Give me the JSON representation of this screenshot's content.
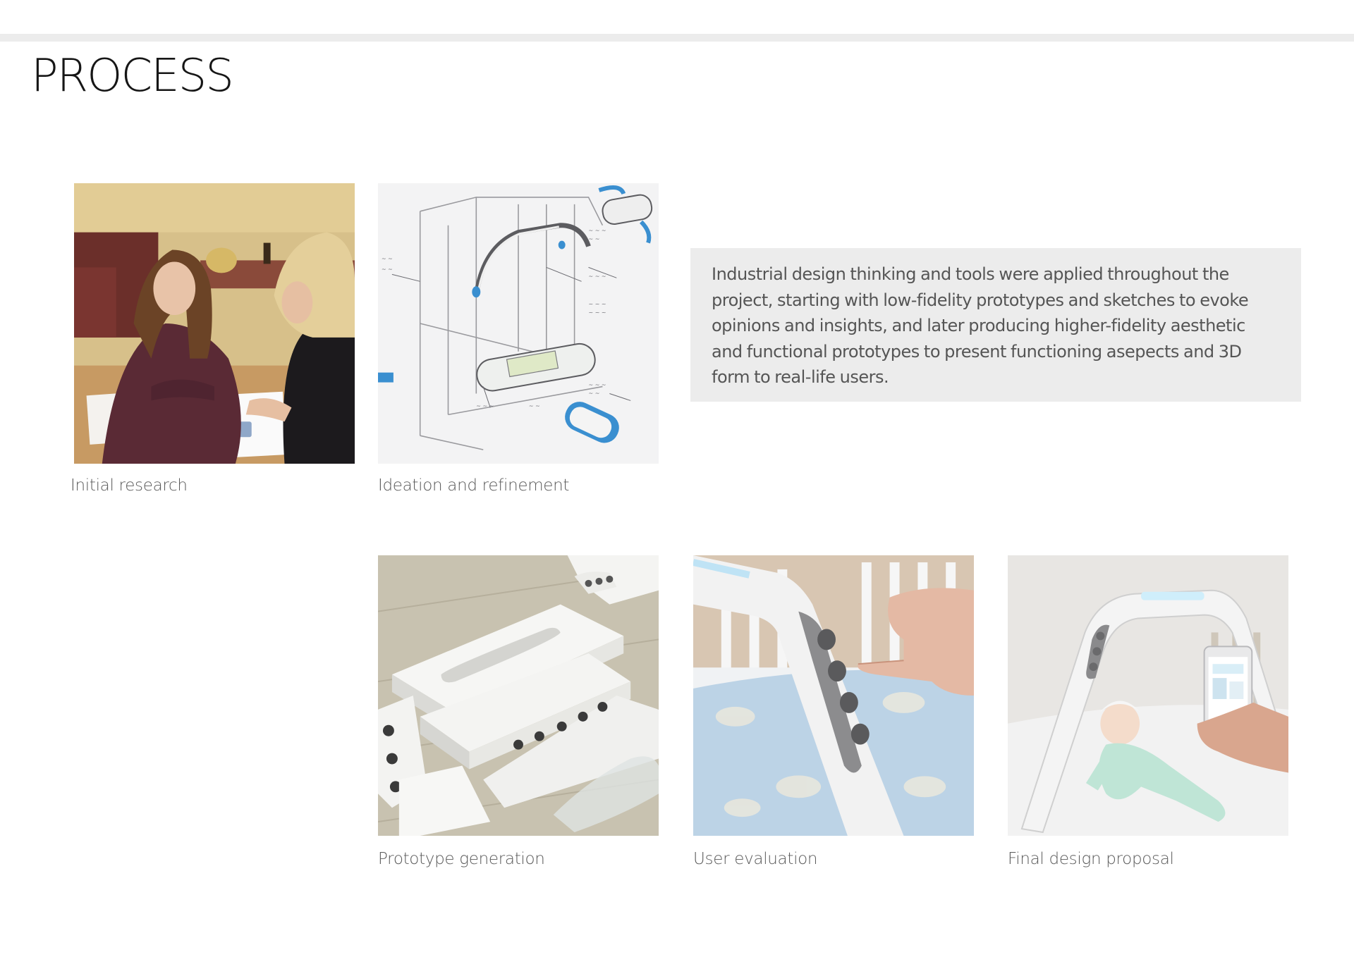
{
  "page": {
    "title": "PROCESS"
  },
  "description": "Industrial design thinking and tools were applied throughout the project, starting with low-fidelity prototypes and sketches to evoke opinions and insights, and later producing higher-fidelity aesthetic and functional prototypes to present functioning asepects and 3D form to real-life users.",
  "steps": [
    {
      "caption": "Initial research"
    },
    {
      "caption": "Ideation and refinement"
    },
    {
      "caption": "Prototype generation"
    },
    {
      "caption": "User evaluation"
    },
    {
      "caption": "Final design proposal"
    }
  ],
  "colors": {
    "rule": "#ececec",
    "panel": "#ececec",
    "title": "#161616",
    "caption": "#5a5a5a",
    "accent": "#3a8fd0"
  }
}
